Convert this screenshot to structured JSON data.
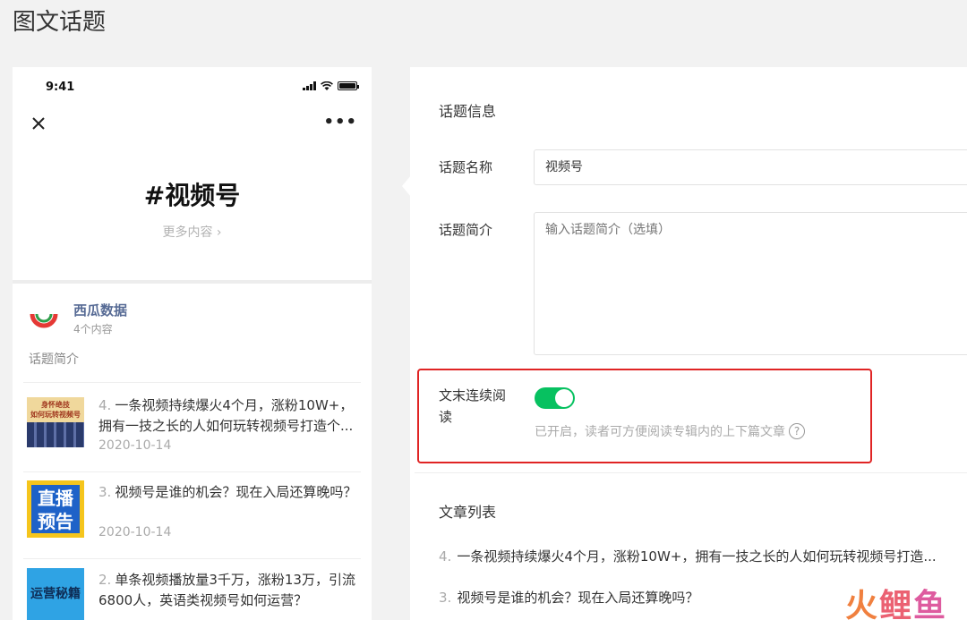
{
  "page_title": "图文话题",
  "phone": {
    "status_time": "9:41",
    "topic_title": "#视频号",
    "more_content": "更多内容 ›",
    "account": {
      "name": "西瓜数据",
      "count": "4个内容"
    },
    "topic_intro_label": "话题简介",
    "articles": [
      {
        "num": "4.",
        "title": "一条视频持续爆火4个月，涨粉10W+，拥有一技之长的人如何玩转视频号打造个...",
        "date": "2020-10-14",
        "thumb_text": [
          "身怀绝技",
          "如何玩转视频号"
        ]
      },
      {
        "num": "3.",
        "title": "视频号是谁的机会？现在入局还算晚吗？",
        "date": "2020-10-14",
        "thumb_text": [
          "直播",
          "预告"
        ]
      },
      {
        "num": "2.",
        "title": "单条视频播放量3千万，涨粉13万，引流6800人，英语类视频号如何运营？",
        "date": "",
        "thumb_text": [
          "运营秘籍"
        ]
      }
    ]
  },
  "form": {
    "section_info": "话题信息",
    "name_label": "话题名称",
    "name_value": "视频号",
    "intro_label": "话题简介",
    "intro_placeholder": "输入话题简介（选填）",
    "continuous_label": "文末连续阅读",
    "continuous_enabled": true,
    "continuous_hint": "已开启，读者可方便阅读专辑内的上下篇文章",
    "help_icon": "?",
    "section_articles": "文章列表",
    "article_list": [
      {
        "num": "4.",
        "title": "一条视频持续爆火4个月，涨粉10W+，拥有一技之长的人如何玩转视频号打造..."
      },
      {
        "num": "3.",
        "title": "视频号是谁的机会？现在入局还算晚吗？"
      }
    ]
  },
  "watermark": [
    "火",
    "鲤",
    "鱼"
  ],
  "colors": {
    "accent_green": "#07c160",
    "link_blue": "#576b95",
    "highlight_red": "#e02424"
  }
}
